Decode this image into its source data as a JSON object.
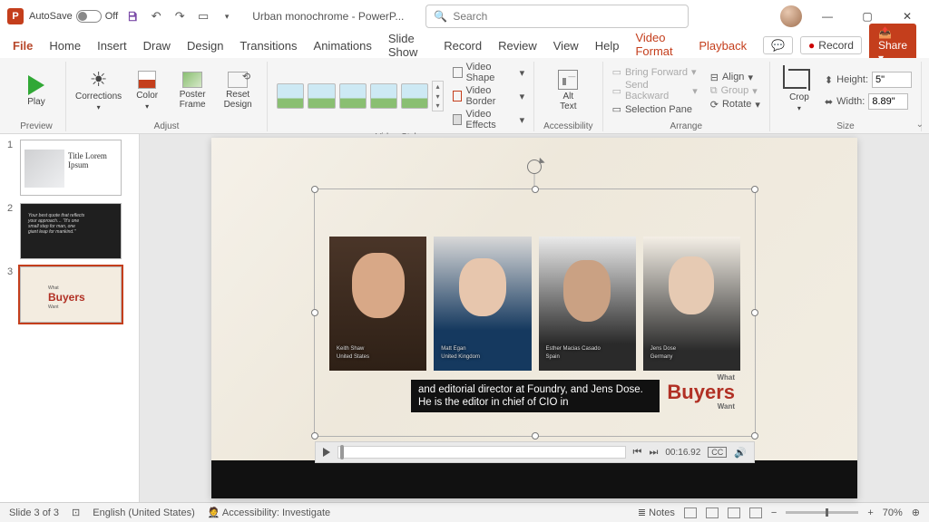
{
  "titlebar": {
    "app_letter": "P",
    "autosave_label": "AutoSave",
    "autosave_state": "Off",
    "doc_name": "Urban monochrome  -  PowerP...",
    "search_placeholder": "Search"
  },
  "window_controls": {
    "min": "—",
    "max": "▢",
    "close": "✕"
  },
  "menu": {
    "file": "File",
    "home": "Home",
    "insert": "Insert",
    "draw": "Draw",
    "design": "Design",
    "transitions": "Transitions",
    "animations": "Animations",
    "slideshow": "Slide Show",
    "record": "Record",
    "review": "Review",
    "view": "View",
    "help": "Help",
    "video_format": "Video Format",
    "playback": "Playback",
    "record_btn": "Record",
    "share": "Share"
  },
  "ribbon": {
    "preview": {
      "play": "Play",
      "group": "Preview"
    },
    "adjust": {
      "corrections": "Corrections",
      "color": "Color",
      "poster": "Poster\nFrame",
      "reset": "Reset\nDesign",
      "group": "Adjust"
    },
    "styles": {
      "shape": "Video Shape",
      "border": "Video Border",
      "effects": "Video Effects",
      "group": "Video Styles"
    },
    "access": {
      "alt": "Alt\nText",
      "group": "Accessibility"
    },
    "arrange": {
      "bring": "Bring Forward",
      "send": "Send Backward",
      "pane": "Selection Pane",
      "align": "Align",
      "group_cmd": "Group",
      "rotate": "Rotate",
      "group": "Arrange"
    },
    "size": {
      "crop": "Crop",
      "height_label": "Height:",
      "height_val": "5\"",
      "width_label": "Width:",
      "width_val": "8.89\"",
      "group": "Size"
    }
  },
  "thumbs": {
    "n1": "1",
    "n2": "2",
    "n3": "3",
    "t1_title": "Title Lorem\nIpsum",
    "t3_small_top": "What",
    "t3_main": "Buyers",
    "t3_small_bot": "Want"
  },
  "video": {
    "people": [
      {
        "name": "Keith Shaw",
        "sub": "United States"
      },
      {
        "name": "Matt Egan",
        "sub": "United Kingdom"
      },
      {
        "name": "Esther Macias Casado",
        "sub": "Spain"
      },
      {
        "name": "Jens Dose",
        "sub": "Germany"
      }
    ],
    "caption": "and editorial director at Foundry, and Jens Dose. He is the editor in chief of CIO in",
    "logo_top": "What",
    "logo_main": "Buyers",
    "logo_bot": "Want",
    "time": "00:16.92",
    "cc": "CC"
  },
  "status": {
    "slide": "Slide 3 of 3",
    "lang": "English (United States)",
    "access": "Accessibility: Investigate",
    "notes": "Notes",
    "zoom": "70%"
  }
}
